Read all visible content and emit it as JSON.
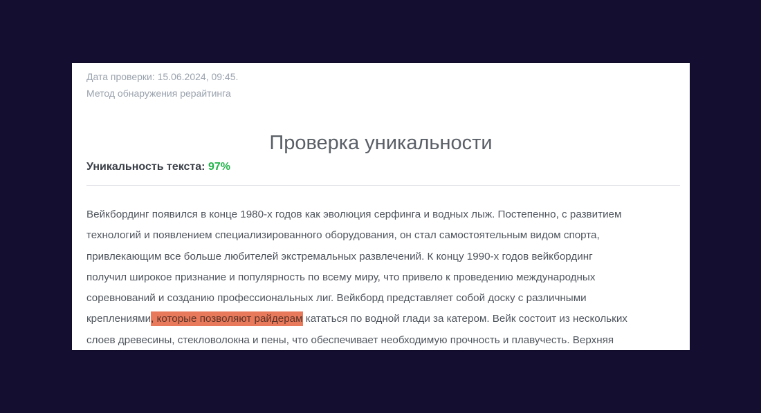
{
  "report": {
    "check_date": "Дата проверки: 15.06.2024, 09:45.",
    "method": "Метод обнаружения рерайтинга",
    "title": "Проверка уникальности",
    "uniqueness_label": "Уникальность текста:",
    "uniqueness_value": "97%",
    "colors": {
      "background": "#140f30",
      "uniqueness_value": "#22b34a",
      "highlight": "#e8795b"
    }
  },
  "text": {
    "lines": [
      {
        "parts": [
          {
            "t": "Вейкбординг появился в конце 1980-х годов как эволюция серфинга и водных лыж. Постепенно, с развитием"
          }
        ]
      },
      {
        "parts": [
          {
            "t": "технологий и появлением специализированного оборудования, он стал самостоятельным видом спорта,"
          }
        ]
      },
      {
        "parts": [
          {
            "t": "привлекающим все больше любителей экстремальных развлечений. К концу 1990-х годов вейкбординг"
          }
        ]
      },
      {
        "parts": [
          {
            "t": "получил широкое признание и популярность по всему миру, что привело к проведению международных"
          }
        ]
      },
      {
        "parts": [
          {
            "t": "соревнований и созданию профессиональных лиг. Вейкборд представляет собой доску с различными"
          }
        ]
      },
      {
        "parts": [
          {
            "t": "креплениями"
          },
          {
            "t": ", которые позволяют райдерам",
            "highlight": true
          },
          {
            "t": " кататься по водной глади за катером. Вейк состоит из нескольких"
          }
        ]
      },
      {
        "parts": [
          {
            "t": "слоев древесины, стекловолокна и пены, что обеспечивает необходимую прочность и плавучесть. Верхняя"
          }
        ]
      }
    ]
  }
}
